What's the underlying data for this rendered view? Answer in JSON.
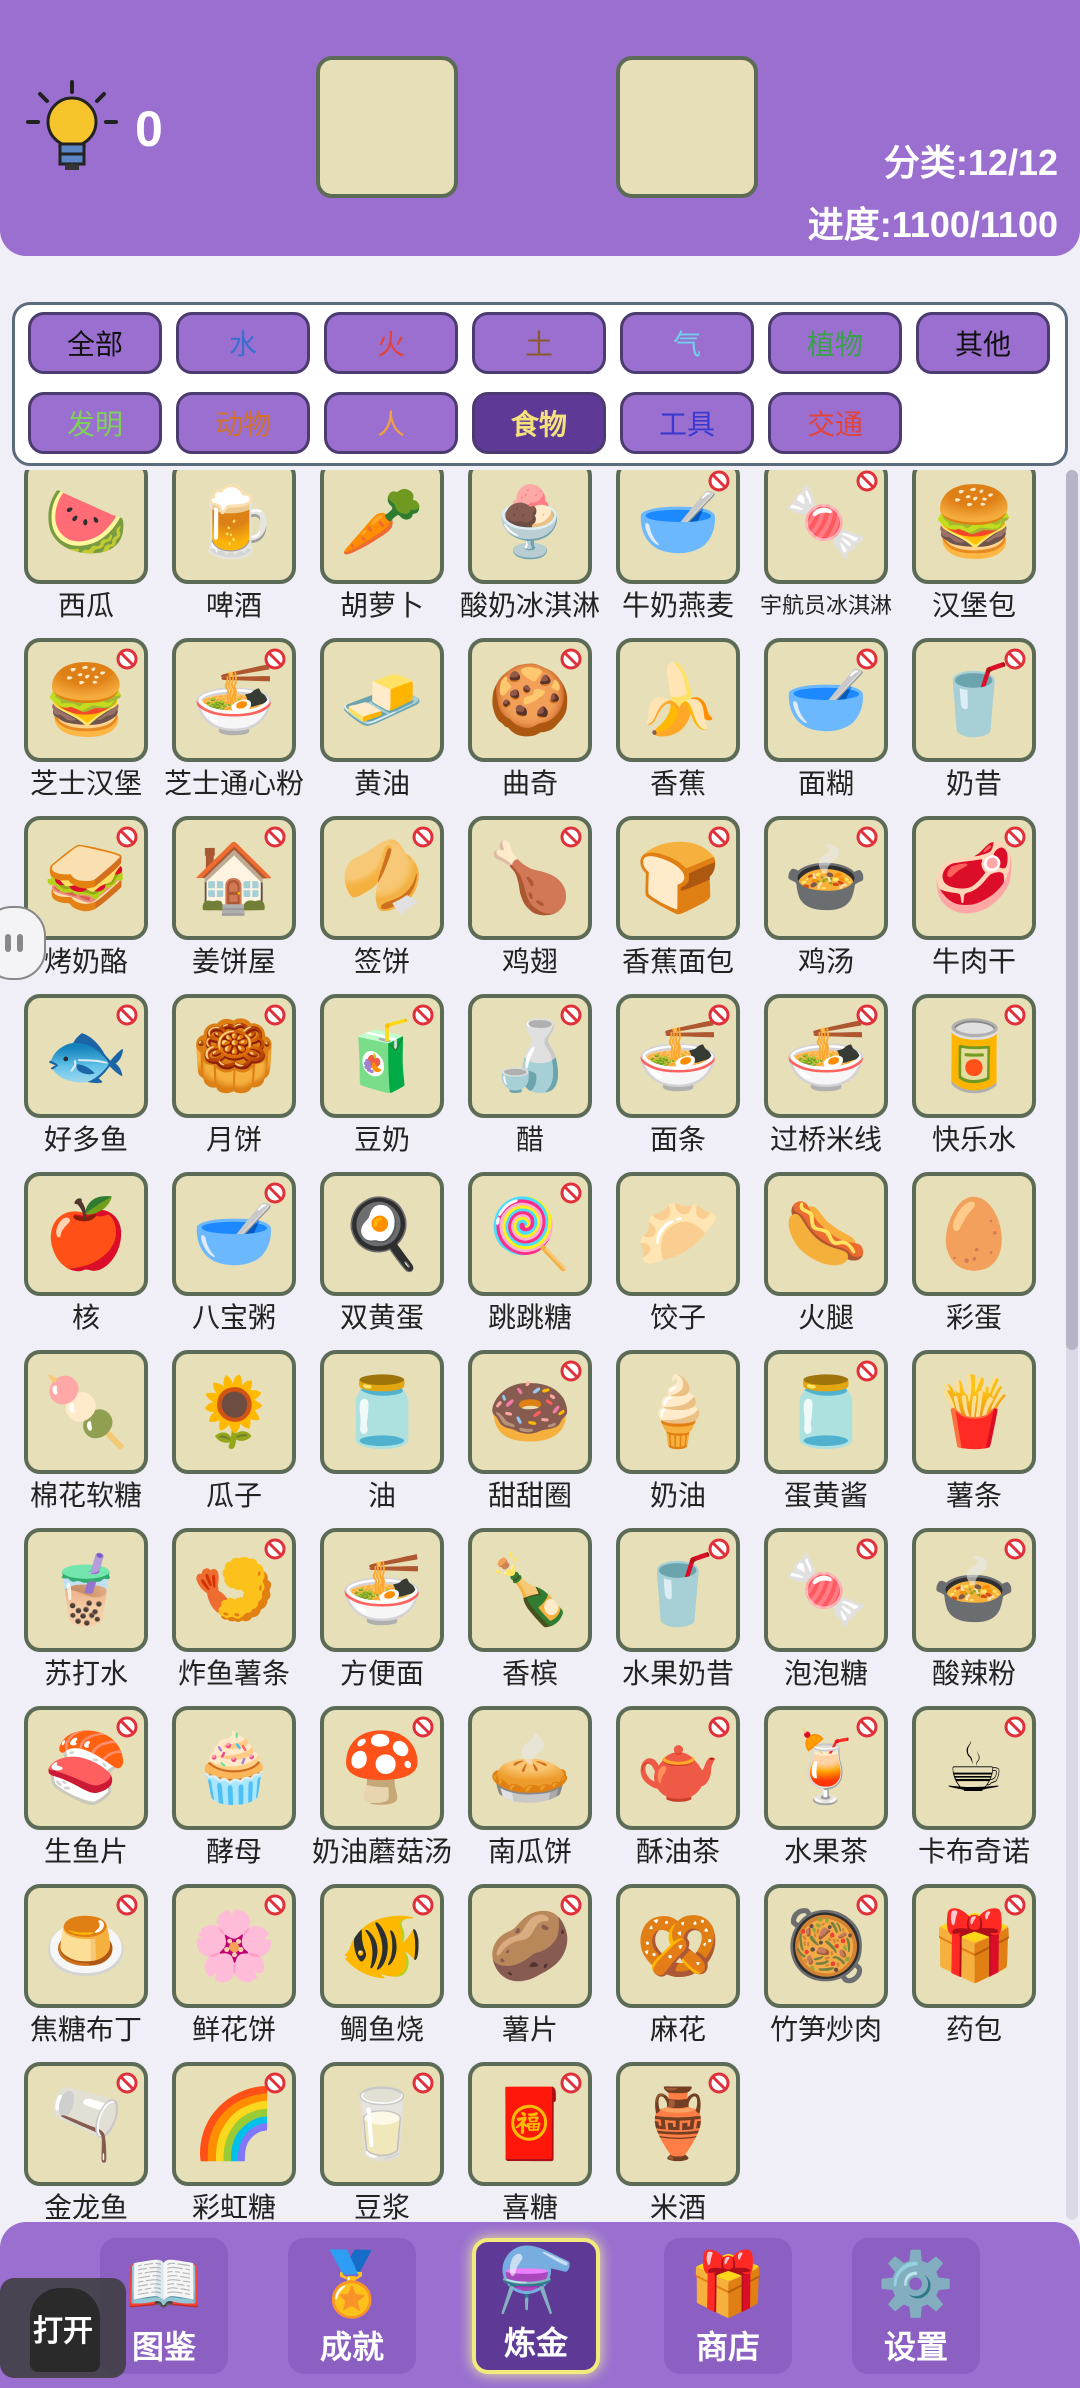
{
  "header": {
    "hint_count": "0",
    "category": "分类:12/12",
    "progress": "进度:1100/1100"
  },
  "filters": [
    {
      "label": "全部",
      "color": "#111111",
      "active": false
    },
    {
      "label": "水",
      "color": "#3a6fd0",
      "active": false
    },
    {
      "label": "火",
      "color": "#e0443a",
      "active": false
    },
    {
      "label": "土",
      "color": "#8a5a2a",
      "active": false
    },
    {
      "label": "气",
      "color": "#6fd0e8",
      "active": false
    },
    {
      "label": "植物",
      "color": "#3aa04a",
      "active": false
    },
    {
      "label": "其他",
      "color": "#111111",
      "active": false
    },
    {
      "label": "发明",
      "color": "#7fd05a",
      "active": false
    },
    {
      "label": "动物",
      "color": "#d0702a",
      "active": false
    },
    {
      "label": "人",
      "color": "#f0a040",
      "active": false
    },
    {
      "label": "食物",
      "color": "#f5e27a",
      "active": true
    },
    {
      "label": "工具",
      "color": "#3a3ad0",
      "active": false
    },
    {
      "label": "交通",
      "color": "#e0443a",
      "active": false
    }
  ],
  "items": [
    {
      "label": "西瓜",
      "icon": "🍉",
      "banned": false
    },
    {
      "label": "啤酒",
      "icon": "🍺",
      "banned": false
    },
    {
      "label": "胡萝卜",
      "icon": "🥕",
      "banned": false
    },
    {
      "label": "酸奶冰淇淋",
      "icon": "🍨",
      "banned": false
    },
    {
      "label": "牛奶燕麦",
      "icon": "🥣",
      "banned": true
    },
    {
      "label": "宇航员冰淇淋",
      "icon": "🍬",
      "banned": true
    },
    {
      "label": "汉堡包",
      "icon": "🍔",
      "banned": false
    },
    {
      "label": "芝士汉堡",
      "icon": "🍔",
      "banned": true
    },
    {
      "label": "芝士通心粉",
      "icon": "🍜",
      "banned": true
    },
    {
      "label": "黄油",
      "icon": "🧈",
      "banned": false
    },
    {
      "label": "曲奇",
      "icon": "🍪",
      "banned": true
    },
    {
      "label": "香蕉",
      "icon": "🍌",
      "banned": false
    },
    {
      "label": "面糊",
      "icon": "🥣",
      "banned": true
    },
    {
      "label": "奶昔",
      "icon": "🥤",
      "banned": true
    },
    {
      "label": "烤奶酪",
      "icon": "🥪",
      "banned": true
    },
    {
      "label": "姜饼屋",
      "icon": "🏠",
      "banned": true
    },
    {
      "label": "签饼",
      "icon": "🥠",
      "banned": true
    },
    {
      "label": "鸡翅",
      "icon": "🍗",
      "banned": true
    },
    {
      "label": "香蕉面包",
      "icon": "🍞",
      "banned": true
    },
    {
      "label": "鸡汤",
      "icon": "🍲",
      "banned": true
    },
    {
      "label": "牛肉干",
      "icon": "🥩",
      "banned": true
    },
    {
      "label": "好多鱼",
      "icon": "🐟",
      "banned": true
    },
    {
      "label": "月饼",
      "icon": "🥮",
      "banned": true
    },
    {
      "label": "豆奶",
      "icon": "🧃",
      "banned": true
    },
    {
      "label": "醋",
      "icon": "🍶",
      "banned": true
    },
    {
      "label": "面条",
      "icon": "🍜",
      "banned": true
    },
    {
      "label": "过桥米线",
      "icon": "🍜",
      "banned": true
    },
    {
      "label": "快乐水",
      "icon": "🥫",
      "banned": true
    },
    {
      "label": "核",
      "icon": "🍎",
      "banned": false
    },
    {
      "label": "八宝粥",
      "icon": "🥣",
      "banned": true
    },
    {
      "label": "双黄蛋",
      "icon": "🍳",
      "banned": false
    },
    {
      "label": "跳跳糖",
      "icon": "🍭",
      "banned": true
    },
    {
      "label": "饺子",
      "icon": "🥟",
      "banned": false
    },
    {
      "label": "火腿",
      "icon": "🌭",
      "banned": false
    },
    {
      "label": "彩蛋",
      "icon": "🥚",
      "banned": false
    },
    {
      "label": "棉花软糖",
      "icon": "🍡",
      "banned": false
    },
    {
      "label": "瓜子",
      "icon": "🌻",
      "banned": false
    },
    {
      "label": "油",
      "icon": "🫙",
      "banned": false
    },
    {
      "label": "甜甜圈",
      "icon": "🍩",
      "banned": true
    },
    {
      "label": "奶油",
      "icon": "🍦",
      "banned": false
    },
    {
      "label": "蛋黄酱",
      "icon": "🫙",
      "banned": true
    },
    {
      "label": "薯条",
      "icon": "🍟",
      "banned": false
    },
    {
      "label": "苏打水",
      "icon": "🧋",
      "banned": false
    },
    {
      "label": "炸鱼薯条",
      "icon": "🍤",
      "banned": true
    },
    {
      "label": "方便面",
      "icon": "🍜",
      "banned": false
    },
    {
      "label": "香槟",
      "icon": "🍾",
      "banned": false
    },
    {
      "label": "水果奶昔",
      "icon": "🥤",
      "banned": true
    },
    {
      "label": "泡泡糖",
      "icon": "🍬",
      "banned": true
    },
    {
      "label": "酸辣粉",
      "icon": "🍲",
      "banned": true
    },
    {
      "label": "生鱼片",
      "icon": "🍣",
      "banned": true
    },
    {
      "label": "酵母",
      "icon": "🧁",
      "banned": false
    },
    {
      "label": "奶油蘑菇汤",
      "icon": "🍄",
      "banned": true
    },
    {
      "label": "南瓜饼",
      "icon": "🥧",
      "banned": false
    },
    {
      "label": "酥油茶",
      "icon": "🫖",
      "banned": true
    },
    {
      "label": "水果茶",
      "icon": "🍹",
      "banned": true
    },
    {
      "label": "卡布奇诺",
      "icon": "☕",
      "banned": true
    },
    {
      "label": "焦糖布丁",
      "icon": "🍮",
      "banned": true
    },
    {
      "label": "鲜花饼",
      "icon": "🌸",
      "banned": true
    },
    {
      "label": "鲷鱼烧",
      "icon": "🐠",
      "banned": true
    },
    {
      "label": "薯片",
      "icon": "🥔",
      "banned": true
    },
    {
      "label": "麻花",
      "icon": "🥨",
      "banned": false
    },
    {
      "label": "竹笋炒肉",
      "icon": "🥘",
      "banned": true
    },
    {
      "label": "药包",
      "icon": "🎁",
      "banned": true
    },
    {
      "label": "金龙鱼",
      "icon": "🫗",
      "banned": true
    },
    {
      "label": "彩虹糖",
      "icon": "🌈",
      "banned": true
    },
    {
      "label": "豆浆",
      "icon": "🥛",
      "banned": true
    },
    {
      "label": "喜糖",
      "icon": "🧧",
      "banned": true
    },
    {
      "label": "米酒",
      "icon": "🏺",
      "banned": true
    }
  ],
  "nav": [
    {
      "label": "图鉴",
      "icon": "📖",
      "active": false
    },
    {
      "label": "成就",
      "icon": "🏅",
      "active": false
    },
    {
      "label": "炼金",
      "icon": "⚗️",
      "active": true
    },
    {
      "label": "商店",
      "icon": "🎁",
      "active": false
    },
    {
      "label": "设置",
      "icon": "⚙️",
      "active": false
    }
  ],
  "open_button": "打开"
}
